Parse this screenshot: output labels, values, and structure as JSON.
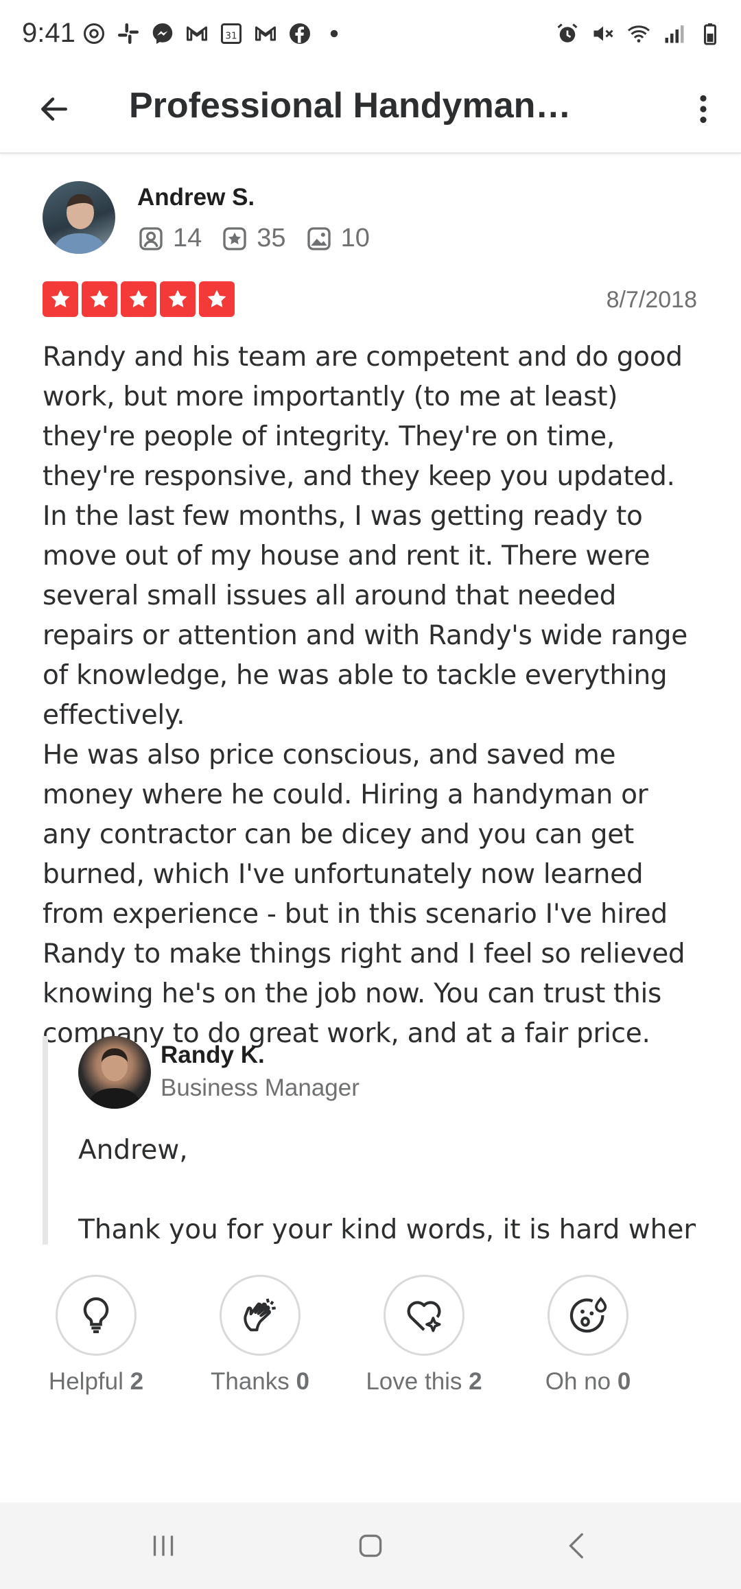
{
  "status_bar": {
    "time": "9:41",
    "left_icons": [
      "threads-icon",
      "slack-icon",
      "messenger-icon",
      "gmail-icon",
      "calendar-icon",
      "gmail-icon",
      "facebook-icon",
      "dot-icon"
    ],
    "right_icons": [
      "alarm-icon",
      "mute-icon",
      "wifi-icon",
      "signal-icon",
      "battery-icon"
    ]
  },
  "app_bar": {
    "title": "Professional Handyman…",
    "back_icon": "arrow-left-icon",
    "more_icon": "more-vertical-icon"
  },
  "review": {
    "reviewer_name": "Andrew S.",
    "stats": {
      "friends": "14",
      "reviews": "35",
      "photos": "10"
    },
    "rating": 5,
    "date": "8/7/2018",
    "paragraphs": [
      "Randy and his team are competent and do good work, but more importantly (to me at least) they're people of integrity. They're on time, they're responsive, and they keep you updated. In the last few months, I was getting ready to move out of my house and rent it. There were several small issues all around that needed repairs or attention and with Randy's wide range of knowledge, he was able to tackle everything effectively.",
      "He was also price conscious, and saved me money where he could. Hiring a handyman or any contractor can be dicey and you can get burned, which I've unfortunately now learned from experience - but in this scenario I've hired Randy to make things right and I feel so relieved knowing he's on the job now. You can trust this company to do great work, and at a fair price."
    ]
  },
  "owner_reply": {
    "name": "Randy K.",
    "role": "Business Manager",
    "greeting": "Andrew,",
    "excerpt": "Thank you for your kind words, it is hard when …"
  },
  "reactions": [
    {
      "label": "Helpful",
      "count": "2",
      "icon": "lightbulb-icon"
    },
    {
      "label": "Thanks",
      "count": "0",
      "icon": "clapping-hands-icon"
    },
    {
      "label": "Love this",
      "count": "2",
      "icon": "heart-sparkle-icon"
    },
    {
      "label": "Oh no",
      "count": "0",
      "icon": "shocked-face-icon"
    }
  ],
  "nav_bar": [
    "recents-icon",
    "home-icon",
    "back-icon"
  ],
  "colors": {
    "star_red": "#f43939",
    "text": "#2d2e2f",
    "muted": "#6e7072"
  }
}
